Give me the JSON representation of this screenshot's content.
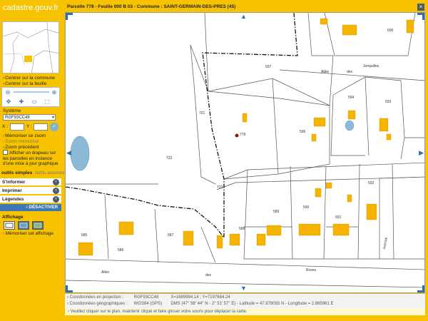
{
  "app": {
    "logo_text": "cadastre.gouv.fr"
  },
  "sidebar": {
    "links_top": [
      "Centrer sur la commune",
      "Centrer sur la feuille"
    ],
    "system_label": "Système",
    "system_value": "RGF93CC48",
    "x_label": "X :",
    "y_label": "Y :",
    "zoom_links": [
      {
        "label": "Mémoriser ce zoom",
        "enabled": true
      },
      {
        "label": "Zoom mémorisé",
        "enabled": false
      },
      {
        "label": "Zoom précédent",
        "enabled": true
      }
    ],
    "flag_text": "Afficher un drapeau sur les parcelles en instance d'une mise à jour graphique",
    "tabs": {
      "active": "outils simples",
      "inactive": "outils avancés"
    },
    "menu": [
      "S'informer",
      "Imprimer",
      "Légendes"
    ],
    "deactivate_label": "DÉSACTIVER",
    "affichage_label": "Affichage",
    "memorize_display": "Mémoriser cet affichage"
  },
  "map": {
    "title": "Parcelle 778 - Feuille 000 B 03 - Commune : SAINT-GERMAIN-DES-PRES (45)",
    "parcels": [
      "600",
      "597",
      "721",
      "778",
      "596",
      "594",
      "593",
      "722",
      "723",
      "592",
      "589",
      "590",
      "591",
      "585",
      "586",
      "587",
      "588"
    ],
    "street_labels": [
      "Allée",
      "des",
      "Jonquilles",
      "Allée",
      "des",
      "Roses",
      "Avenue"
    ]
  },
  "status": {
    "proj_label": "Coordonnées en projection :",
    "proj_system": "RGF93CC48",
    "proj_values": "X=1689994.14 ; Y=7197684.24",
    "geo_label": "Coordonnées géographiques :",
    "geo_system": "WGS84 (GPS)",
    "geo_values": "DMS (47° 58' 44'' N - 2° 51' 57'' E) - Latitude = 47.979093 N - Longitude = 2.865961 E"
  },
  "hint": "Veuillez cliquer sur le plan, maintenir cliqué et faire glisser votre souris pour déplacer la carte.",
  "colors": {
    "frame": "#f7c300",
    "accent": "#3b78b4",
    "building": "#f5b400",
    "water": "#7fb3d6"
  },
  "icons": [
    "close-icon",
    "zoom-out-icon",
    "zoom-in-icon",
    "pan-icon",
    "select-icon",
    "measure-icon",
    "go-icon",
    "expand-icon"
  ]
}
